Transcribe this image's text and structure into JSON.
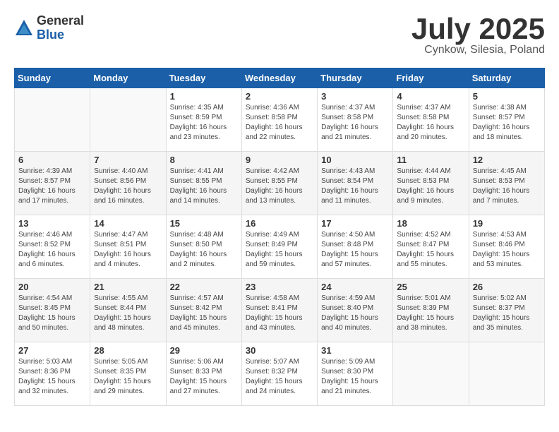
{
  "logo": {
    "general": "General",
    "blue": "Blue"
  },
  "title": "July 2025",
  "subtitle": "Cynkow, Silesia, Poland",
  "days_header": [
    "Sunday",
    "Monday",
    "Tuesday",
    "Wednesday",
    "Thursday",
    "Friday",
    "Saturday"
  ],
  "weeks": [
    [
      {
        "day": "",
        "info": ""
      },
      {
        "day": "",
        "info": ""
      },
      {
        "day": "1",
        "info": "Sunrise: 4:35 AM\nSunset: 8:59 PM\nDaylight: 16 hours\nand 23 minutes."
      },
      {
        "day": "2",
        "info": "Sunrise: 4:36 AM\nSunset: 8:58 PM\nDaylight: 16 hours\nand 22 minutes."
      },
      {
        "day": "3",
        "info": "Sunrise: 4:37 AM\nSunset: 8:58 PM\nDaylight: 16 hours\nand 21 minutes."
      },
      {
        "day": "4",
        "info": "Sunrise: 4:37 AM\nSunset: 8:58 PM\nDaylight: 16 hours\nand 20 minutes."
      },
      {
        "day": "5",
        "info": "Sunrise: 4:38 AM\nSunset: 8:57 PM\nDaylight: 16 hours\nand 18 minutes."
      }
    ],
    [
      {
        "day": "6",
        "info": "Sunrise: 4:39 AM\nSunset: 8:57 PM\nDaylight: 16 hours\nand 17 minutes."
      },
      {
        "day": "7",
        "info": "Sunrise: 4:40 AM\nSunset: 8:56 PM\nDaylight: 16 hours\nand 16 minutes."
      },
      {
        "day": "8",
        "info": "Sunrise: 4:41 AM\nSunset: 8:55 PM\nDaylight: 16 hours\nand 14 minutes."
      },
      {
        "day": "9",
        "info": "Sunrise: 4:42 AM\nSunset: 8:55 PM\nDaylight: 16 hours\nand 13 minutes."
      },
      {
        "day": "10",
        "info": "Sunrise: 4:43 AM\nSunset: 8:54 PM\nDaylight: 16 hours\nand 11 minutes."
      },
      {
        "day": "11",
        "info": "Sunrise: 4:44 AM\nSunset: 8:53 PM\nDaylight: 16 hours\nand 9 minutes."
      },
      {
        "day": "12",
        "info": "Sunrise: 4:45 AM\nSunset: 8:53 PM\nDaylight: 16 hours\nand 7 minutes."
      }
    ],
    [
      {
        "day": "13",
        "info": "Sunrise: 4:46 AM\nSunset: 8:52 PM\nDaylight: 16 hours\nand 6 minutes."
      },
      {
        "day": "14",
        "info": "Sunrise: 4:47 AM\nSunset: 8:51 PM\nDaylight: 16 hours\nand 4 minutes."
      },
      {
        "day": "15",
        "info": "Sunrise: 4:48 AM\nSunset: 8:50 PM\nDaylight: 16 hours\nand 2 minutes."
      },
      {
        "day": "16",
        "info": "Sunrise: 4:49 AM\nSunset: 8:49 PM\nDaylight: 15 hours\nand 59 minutes."
      },
      {
        "day": "17",
        "info": "Sunrise: 4:50 AM\nSunset: 8:48 PM\nDaylight: 15 hours\nand 57 minutes."
      },
      {
        "day": "18",
        "info": "Sunrise: 4:52 AM\nSunset: 8:47 PM\nDaylight: 15 hours\nand 55 minutes."
      },
      {
        "day": "19",
        "info": "Sunrise: 4:53 AM\nSunset: 8:46 PM\nDaylight: 15 hours\nand 53 minutes."
      }
    ],
    [
      {
        "day": "20",
        "info": "Sunrise: 4:54 AM\nSunset: 8:45 PM\nDaylight: 15 hours\nand 50 minutes."
      },
      {
        "day": "21",
        "info": "Sunrise: 4:55 AM\nSunset: 8:44 PM\nDaylight: 15 hours\nand 48 minutes."
      },
      {
        "day": "22",
        "info": "Sunrise: 4:57 AM\nSunset: 8:42 PM\nDaylight: 15 hours\nand 45 minutes."
      },
      {
        "day": "23",
        "info": "Sunrise: 4:58 AM\nSunset: 8:41 PM\nDaylight: 15 hours\nand 43 minutes."
      },
      {
        "day": "24",
        "info": "Sunrise: 4:59 AM\nSunset: 8:40 PM\nDaylight: 15 hours\nand 40 minutes."
      },
      {
        "day": "25",
        "info": "Sunrise: 5:01 AM\nSunset: 8:39 PM\nDaylight: 15 hours\nand 38 minutes."
      },
      {
        "day": "26",
        "info": "Sunrise: 5:02 AM\nSunset: 8:37 PM\nDaylight: 15 hours\nand 35 minutes."
      }
    ],
    [
      {
        "day": "27",
        "info": "Sunrise: 5:03 AM\nSunset: 8:36 PM\nDaylight: 15 hours\nand 32 minutes."
      },
      {
        "day": "28",
        "info": "Sunrise: 5:05 AM\nSunset: 8:35 PM\nDaylight: 15 hours\nand 29 minutes."
      },
      {
        "day": "29",
        "info": "Sunrise: 5:06 AM\nSunset: 8:33 PM\nDaylight: 15 hours\nand 27 minutes."
      },
      {
        "day": "30",
        "info": "Sunrise: 5:07 AM\nSunset: 8:32 PM\nDaylight: 15 hours\nand 24 minutes."
      },
      {
        "day": "31",
        "info": "Sunrise: 5:09 AM\nSunset: 8:30 PM\nDaylight: 15 hours\nand 21 minutes."
      },
      {
        "day": "",
        "info": ""
      },
      {
        "day": "",
        "info": ""
      }
    ]
  ]
}
